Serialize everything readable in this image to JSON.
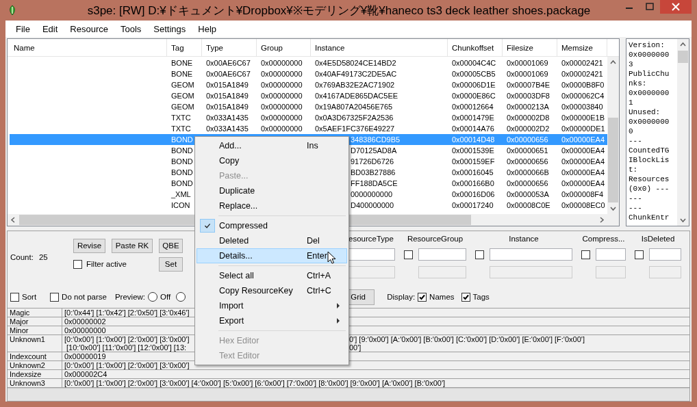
{
  "window": {
    "title": "s3pe: [RW] D:¥ドキュメント¥Dropbox¥※モデリング¥靴¥haneco ts3 deck leather shoes.package"
  },
  "menubar": [
    "File",
    "Edit",
    "Resource",
    "Tools",
    "Settings",
    "Help"
  ],
  "table": {
    "columns": [
      "Name",
      "Tag",
      "Type",
      "Group",
      "Instance",
      "Chunkoffset",
      "Filesize",
      "Memsize"
    ],
    "rows": [
      {
        "tag": "BONE",
        "type": "0x00AE6C67",
        "group": "0x00000000",
        "instance": "0x4E5D58024CE14BD2",
        "chunkoffset": "0x00004C4C",
        "filesize": "0x00001069",
        "memsize": "0x00002421",
        "selected": false
      },
      {
        "tag": "BONE",
        "type": "0x00AE6C67",
        "group": "0x00000000",
        "instance": "0x40AF49173C2DE5AC",
        "chunkoffset": "0x00005CB5",
        "filesize": "0x00001069",
        "memsize": "0x00002421",
        "selected": false
      },
      {
        "tag": "GEOM",
        "type": "0x015A1849",
        "group": "0x00000000",
        "instance": "0x769AB32E2AC71902",
        "chunkoffset": "0x00006D1E",
        "filesize": "0x00007B4E",
        "memsize": "0x0000B8F0",
        "selected": false
      },
      {
        "tag": "GEOM",
        "type": "0x015A1849",
        "group": "0x00000000",
        "instance": "0x4167ADE865DAC5EE",
        "chunkoffset": "0x0000E86C",
        "filesize": "0x00003DF8",
        "memsize": "0x000062C4",
        "selected": false
      },
      {
        "tag": "GEOM",
        "type": "0x015A1849",
        "group": "0x00000000",
        "instance": "0x19A807A20456E765",
        "chunkoffset": "0x00012664",
        "filesize": "0x0000213A",
        "memsize": "0x00003840",
        "selected": false
      },
      {
        "tag": "TXTC",
        "type": "0x033A1435",
        "group": "0x00000000",
        "instance": "0x0A3D67325F2A2536",
        "chunkoffset": "0x0001479E",
        "filesize": "0x000002D8",
        "memsize": "0x00000E1B",
        "selected": false
      },
      {
        "tag": "TXTC",
        "type": "0x033A1435",
        "group": "0x00000000",
        "instance": "0x5AEF1FC376E49227",
        "chunkoffset": "0x00014A76",
        "filesize": "0x000002D2",
        "memsize": "0x00000DE1",
        "selected": false
      },
      {
        "tag": "BOND",
        "instance": "348386CD9B5",
        "chunkoffset": "0x00014D48",
        "filesize": "0x00000656",
        "memsize": "0x00000EA4",
        "selected": true
      },
      {
        "tag": "BOND",
        "instance": "D70125AD8A",
        "chunkoffset": "0x0001539E",
        "filesize": "0x00000651",
        "memsize": "0x00000EA4",
        "selected": false
      },
      {
        "tag": "BOND",
        "instance": "91726D6726",
        "chunkoffset": "0x000159EF",
        "filesize": "0x00000656",
        "memsize": "0x00000EA4",
        "selected": false
      },
      {
        "tag": "BOND",
        "instance": "BD03B27886",
        "chunkoffset": "0x00016045",
        "filesize": "0x0000066B",
        "memsize": "0x00000EA4",
        "selected": false
      },
      {
        "tag": "BOND",
        "instance": "FF188DA5CE",
        "chunkoffset": "0x000166B0",
        "filesize": "0x00000656",
        "memsize": "0x00000EA4",
        "selected": false
      },
      {
        "tag": "_XML",
        "instance": "0000000000",
        "chunkoffset": "0x00016D06",
        "filesize": "0x0000053A",
        "memsize": "0x000008F4",
        "selected": false
      },
      {
        "tag": "ICON",
        "instance": "D400000000",
        "chunkoffset": "0x00017240",
        "filesize": "0x00008C0E",
        "memsize": "0x00008EC0",
        "selected": false
      }
    ]
  },
  "info_pane": {
    "lines": [
      "Version:",
      "0x0000000",
      "3",
      "PublicChu",
      "nks:",
      "0x0000000",
      "1",
      "Unused:",
      "0x0000000",
      "0",
      "---",
      "CountedTG",
      "IBlockLis",
      "t:",
      "Resources",
      "(0x0) ---",
      "---",
      "---",
      "ChunkEntr"
    ]
  },
  "filter": {
    "count_label": "Count:",
    "count": "25",
    "buttons": [
      "Revise",
      "Paste RK",
      "QBE",
      "Set"
    ],
    "filter_active": {
      "label": "Filter active",
      "checked": false
    },
    "columns": [
      {
        "label": "esourceType"
      },
      {
        "label": "ResourceGroup",
        "checked": false
      },
      {
        "label": "Instance",
        "checked": false
      },
      {
        "label": "Compress...",
        "checked": false
      },
      {
        "label": "IsDeleted",
        "checked": false
      }
    ],
    "sort": {
      "label": "Sort",
      "checked": false
    },
    "do_not_parse": {
      "label": "Do not parse",
      "checked": false
    },
    "preview": {
      "label": "Preview:",
      "options": [
        {
          "label": "Off",
          "selected": false
        },
        {
          "selected": false
        }
      ]
    },
    "grid_button": "Grid",
    "display": {
      "label": "Display:",
      "options": [
        {
          "label": "Names",
          "checked": true
        },
        {
          "label": "Tags",
          "checked": true
        }
      ]
    }
  },
  "property_grid": [
    {
      "name": "Magic",
      "lines": [
        {
          "left": "[0:'0x44'] [1:'0x42'] [2:'0x50'] [3:'0x46']"
        }
      ]
    },
    {
      "name": "Major",
      "lines": [
        {
          "left": "0x00000002"
        }
      ]
    },
    {
      "name": "Minor",
      "lines": [
        {
          "left": "0x00000000"
        }
      ]
    },
    {
      "name": "Unknown1",
      "lines": [
        {
          "left": "[0:'0x00'] [1:'0x00'] [2:'0x00'] [3:'0x00']",
          "right": "0'] [9:'0x00'] [A:'0x00'] [B:'0x00'] [C:'0x00'] [D:'0x00'] [E:'0x00'] [F:'0x00']"
        },
        {
          "left": " [10:'0x00'] [11:'0x00'] [12:'0x00'] [13:",
          "right": "00']"
        }
      ]
    },
    {
      "name": "Indexcount",
      "lines": [
        {
          "left": "0x00000019"
        }
      ]
    },
    {
      "name": "Unknown2",
      "lines": [
        {
          "left": "[0:'0x00'] [1:'0x00'] [2:'0x00'] [3:'0x00']"
        }
      ]
    },
    {
      "name": "Indexsize",
      "lines": [
        {
          "left": "0x000002C4"
        }
      ]
    },
    {
      "name": "Unknown3",
      "lines": [
        {
          "left": "[0:'0x00'] [1:'0x00'] [2:'0x00'] [3:'0x00'] [4:'0x00'] [5:'0x00'] [6:'0x00'] [7:'0x00'] [8:'0x00'] [9:'0x00'] [A:'0x00'] [B:'0x00']"
        }
      ]
    }
  ],
  "context_menu": [
    {
      "kind": "item",
      "label": "Add...",
      "shortcut": "Ins",
      "checked": false,
      "disabled": false,
      "selected": false
    },
    {
      "kind": "item",
      "label": "Copy",
      "checked": false,
      "disabled": false,
      "selected": false
    },
    {
      "kind": "item",
      "label": "Paste...",
      "checked": false,
      "disabled": true,
      "selected": false
    },
    {
      "kind": "item",
      "label": "Duplicate",
      "checked": false,
      "disabled": false,
      "selected": false
    },
    {
      "kind": "item",
      "label": "Replace...",
      "checked": false,
      "disabled": false,
      "selected": false
    },
    {
      "kind": "separator"
    },
    {
      "kind": "item",
      "label": "Compressed",
      "checked": true,
      "disabled": false,
      "selected": false
    },
    {
      "kind": "item",
      "label": "Deleted",
      "shortcut": "Del",
      "checked": false,
      "disabled": false,
      "selected": false
    },
    {
      "kind": "item",
      "label": "Details...",
      "shortcut": "Enter",
      "checked": false,
      "disabled": false,
      "selected": true
    },
    {
      "kind": "separator"
    },
    {
      "kind": "item",
      "label": "Select all",
      "shortcut": "Ctrl+A",
      "checked": false,
      "disabled": false,
      "selected": false
    },
    {
      "kind": "item",
      "label": "Copy ResourceKey",
      "shortcut": "Ctrl+C",
      "checked": false,
      "disabled": false,
      "selected": false
    },
    {
      "kind": "item",
      "label": "Import",
      "submenu": true,
      "checked": false,
      "disabled": false,
      "selected": false
    },
    {
      "kind": "item",
      "label": "Export",
      "submenu": true,
      "checked": false,
      "disabled": false,
      "selected": false
    },
    {
      "kind": "separator"
    },
    {
      "kind": "item",
      "label": "Hex Editor",
      "checked": false,
      "disabled": true,
      "selected": false
    },
    {
      "kind": "item",
      "label": "Text Editor",
      "checked": false,
      "disabled": true,
      "selected": false
    }
  ]
}
